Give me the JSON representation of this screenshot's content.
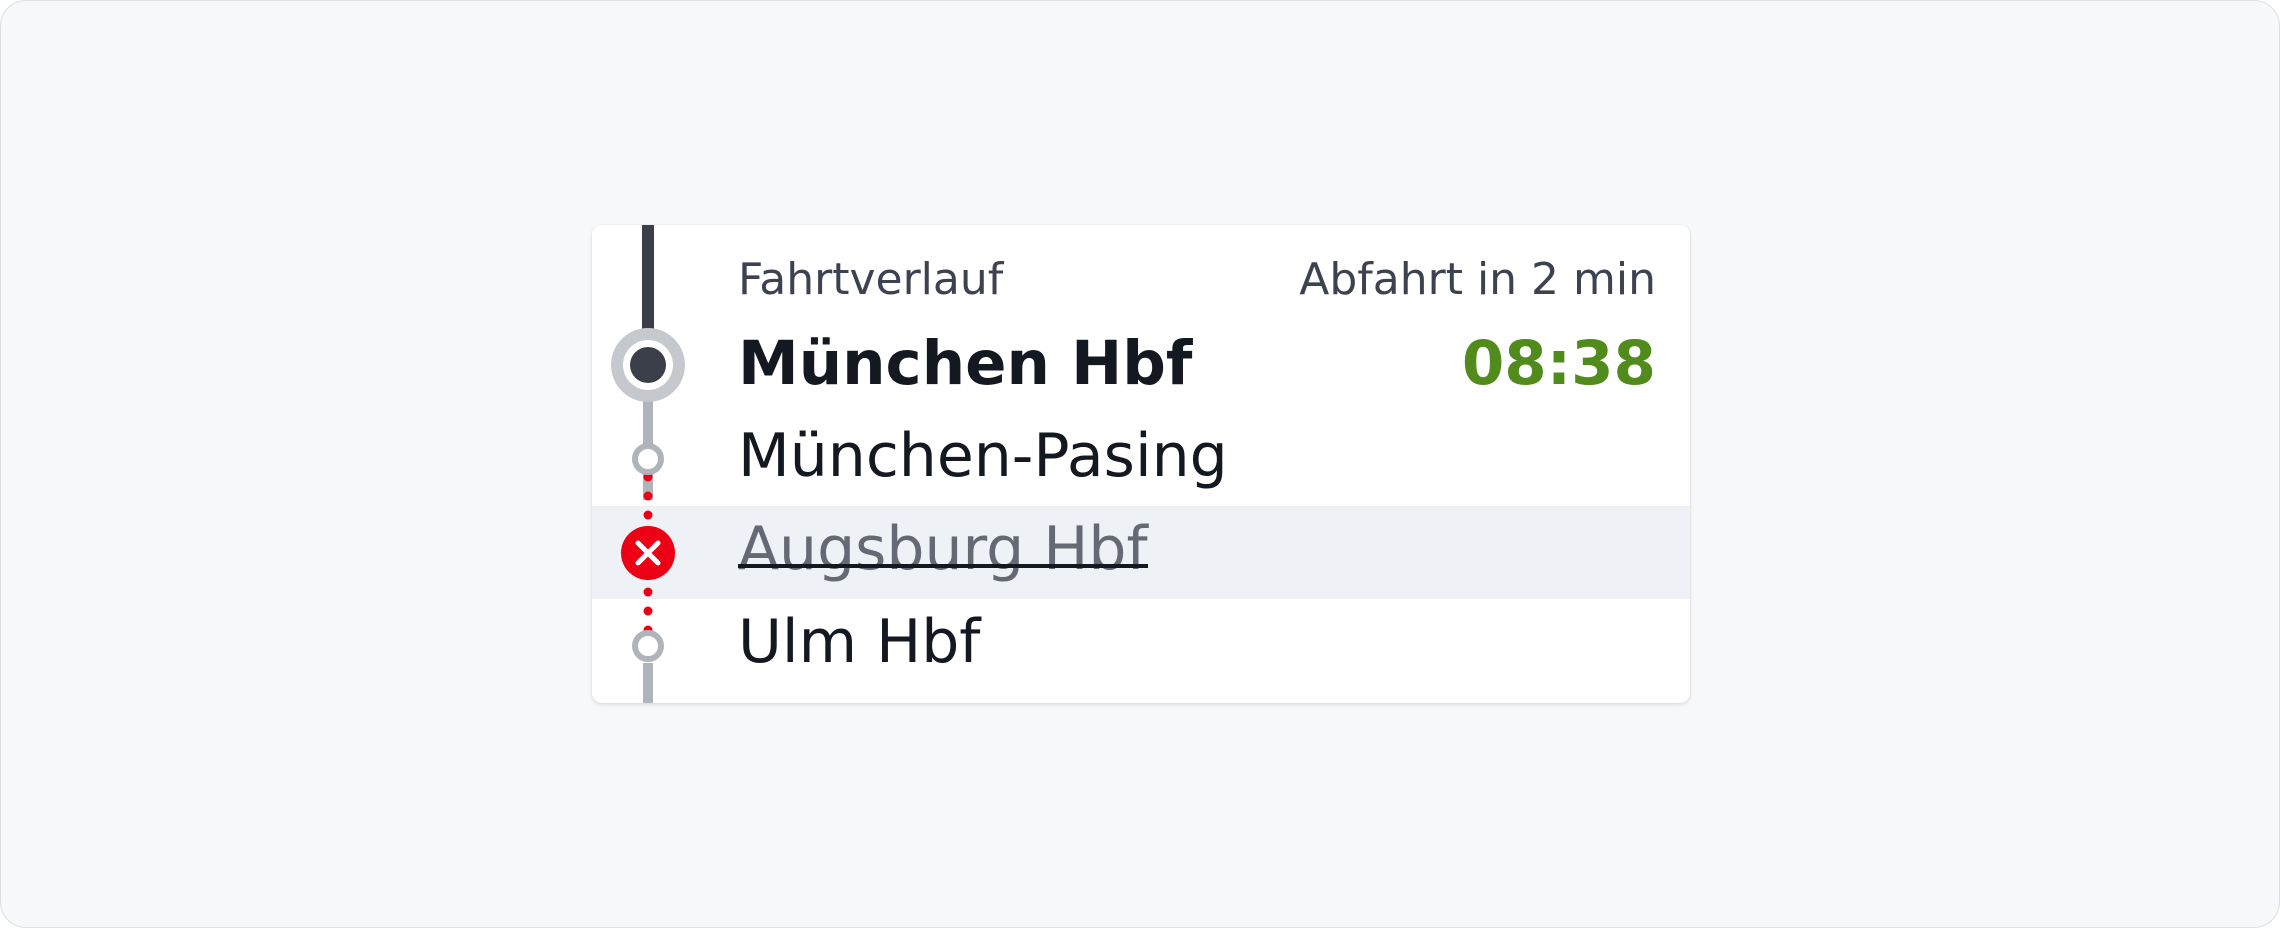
{
  "header": {
    "label": "Fahrtverlauf",
    "departure_info": "Abfahrt in 2 min"
  },
  "stops": [
    {
      "name": "München Hbf",
      "time": "08:38",
      "status": "current"
    },
    {
      "name": "München-Pasing",
      "status": "upcoming"
    },
    {
      "name": "Augsburg Hbf",
      "status": "cancelled"
    },
    {
      "name": "Ulm Hbf",
      "status": "upcoming"
    }
  ],
  "icons": {
    "current": "current-stop-icon",
    "upcoming": "stop-circle-icon",
    "cancelled": "cancelled-x-icon"
  },
  "colors": {
    "line_travelled": "#3b3f4a",
    "line_upcoming": "#afb4bb",
    "line_cancelled": "#ec0016",
    "time_on_schedule": "#508b1b",
    "cancelled_row_bg": "#eef1f5"
  }
}
